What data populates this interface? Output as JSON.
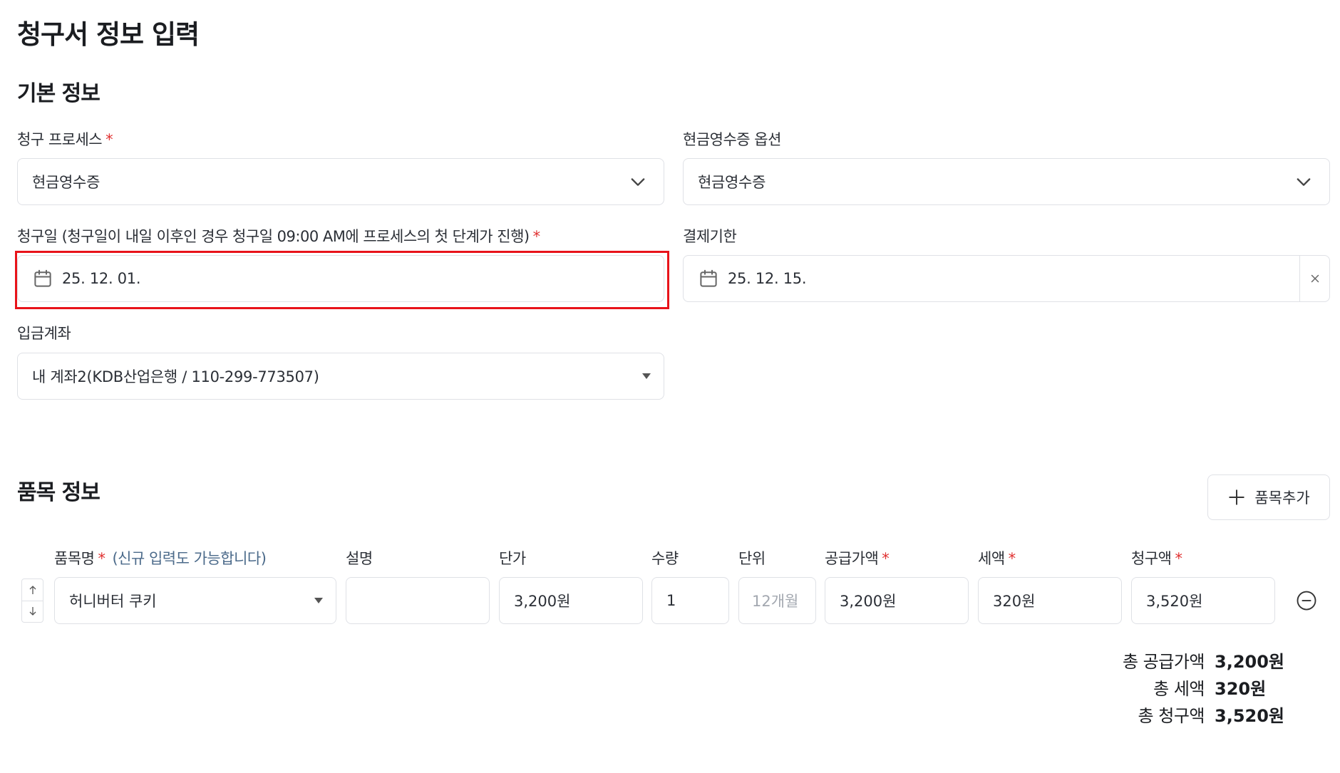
{
  "page": {
    "title": "청구서 정보 입력"
  },
  "basic_section": {
    "title": "기본 정보",
    "billing_process": {
      "label": "청구 프로세스",
      "required_mark": "*",
      "value": "현금영수증"
    },
    "cash_receipt_option": {
      "label": "현금영수증 옵션",
      "value": "현금영수증"
    },
    "billing_date": {
      "label": "청구일 (청구일이 내일 이후인 경우 청구일 09:00 AM에 프로세스의 첫 단계가 진행)",
      "required_mark": "*",
      "value": "25. 12. 01."
    },
    "due_date": {
      "label": "결제기한",
      "value": "25. 12. 15."
    },
    "deposit_account": {
      "label": "입금계좌",
      "value": "내 계좌2(KDB산업은행 / 110-299-773507)"
    }
  },
  "items_section": {
    "title": "품목 정보",
    "add_button_label": "품목추가",
    "columns": {
      "name": "품목명",
      "name_hint": "(신규 입력도 가능합니다)",
      "description": "설명",
      "unit_price": "단가",
      "quantity": "수량",
      "unit": "단위",
      "supply_amount": "공급가액",
      "tax": "세액",
      "billing_amount": "청구액",
      "required_mark": "*"
    },
    "rows": [
      {
        "name": "허니버터 쿠키",
        "description": "",
        "unit_price": "3,200원",
        "quantity": "1",
        "unit_placeholder": "12개월",
        "supply_amount": "3,200원",
        "tax": "320원",
        "billing_amount": "3,520원"
      }
    ],
    "totals": {
      "supply_label": "총 공급가액",
      "supply_value": "3,200원",
      "tax_label": "총 세액",
      "tax_value": "320원",
      "billing_label": "총 청구액",
      "billing_value": "3,520원"
    }
  },
  "colors": {
    "highlight": "#e8131a",
    "required": "#e03131",
    "hint": "#4b6a8a",
    "border": "#dfe1e6"
  }
}
